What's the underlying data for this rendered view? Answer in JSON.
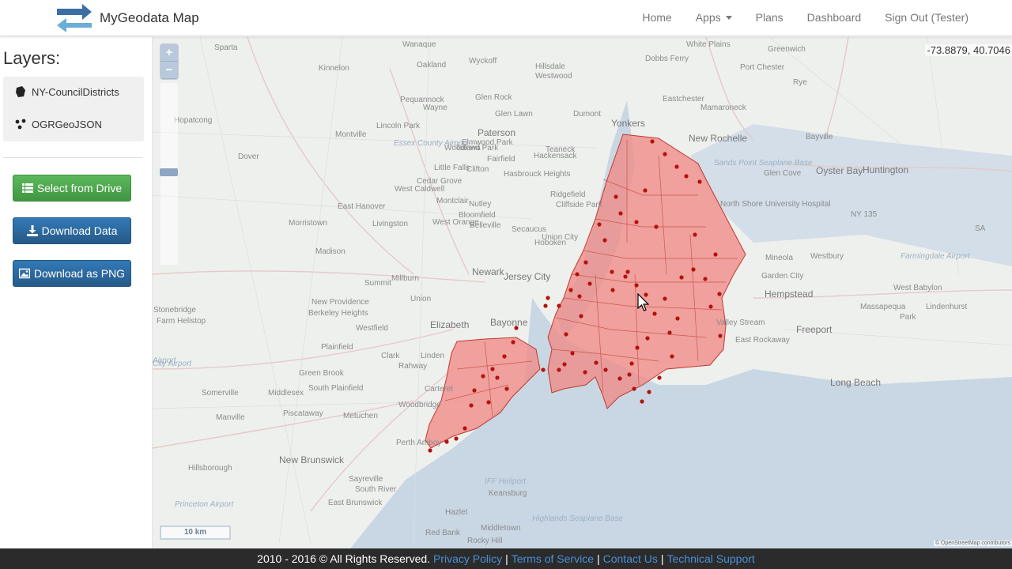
{
  "navbar": {
    "brand": "MyGeodata Map",
    "items": [
      {
        "label": "Home"
      },
      {
        "label": "Apps"
      },
      {
        "label": "Plans"
      },
      {
        "label": "Dashboard"
      },
      {
        "label": "Sign Out (Tester)"
      }
    ]
  },
  "sidebar": {
    "title": "Layers:",
    "layers": [
      {
        "label": "NY-CouncilDistricts",
        "icon": "polygon-icon"
      },
      {
        "label": "OGRGeoJSON",
        "icon": "points-icon"
      }
    ],
    "buttons": {
      "select_drive": "Select from Drive",
      "download_data": "Download Data",
      "download_png": "Download as PNG"
    }
  },
  "map": {
    "zoom_in": "+",
    "zoom_out": "−",
    "coordinates": "-73.8879, 40.7046",
    "scale": "10 km",
    "attribution": "© OpenStreetMap contributors",
    "labels": [
      "Sparta",
      "Wanaque",
      "Oakland",
      "Wyckoff",
      "Hillsdale",
      "Westwood",
      "Dobbs Ferry",
      "White Plains",
      "Greenwich",
      "Port Chester",
      "Rye",
      "Kinnelon",
      "Pequannock",
      "Wayne",
      "Glen Rock",
      "Glen Lawn",
      "Dumont",
      "Yonkers",
      "Eastchester",
      "Mamaroneck",
      "Hopatcong",
      "Lincoln Park",
      "Paterson",
      "Clifton",
      "Elmwood Park",
      "Teaneck",
      "Hackensack",
      "New Rochelle",
      "Bayville",
      "Montville",
      "Totowa",
      "Woodland Park",
      "Essex County Airport",
      "Dover",
      "Fairfield",
      "Little Falls",
      "Hasbrouck Heights",
      "Sands Point Seaplane Base",
      "Glen Cove",
      "Oyster Bay",
      "Huntington",
      "West Caldwell",
      "Cedar Grove",
      "Ridgefield",
      "Cliffside Park",
      "Montclair",
      "Nutley",
      "Bloomfield",
      "East Hanover",
      "Belleville",
      "Secaucus",
      "North Shore University Hospital",
      "NY 135",
      "SA",
      "Morristown",
      "Livingston",
      "West Orange",
      "Union City",
      "Hoboken",
      "Madison",
      "Newark",
      "Jersey City",
      "Mineola",
      "Westbury",
      "Farmingdale Airport",
      "Summit",
      "Millburn",
      "Garden City",
      "West Babylon",
      "Hempstead",
      "New Providence",
      "Union",
      "Massapequa",
      "Lindenhurst",
      "Park",
      "Berkeley Heights",
      "Elizabeth",
      "Bayonne",
      "Valley Stream",
      "Freeport",
      "East Rockaway",
      "Stonebridge",
      "Farm Helistop",
      "Westfield",
      "Plainfield",
      "Clark",
      "Rahway",
      "Linden",
      "Long Beach",
      "Green Brook",
      "Middlesex",
      "South Plainfield",
      "Somerville",
      "Carteret",
      "Woodbridge",
      "Manville",
      "Piscataway",
      "Metuchen",
      "Perth Amboy",
      "New Brunswick",
      "Hillsborough",
      "Sayreville",
      "South River",
      "IFF Heliport",
      "Keansburg",
      "East Brunswick",
      "Hazlet",
      "Middletown",
      "Red Bank",
      "Princeton Airport",
      "Highlands Seaplane Base",
      "City Airport",
      "Airport",
      "Rocky Hill"
    ]
  },
  "footer": {
    "copyright": "2010 - 2016 © All Rights Reserved.",
    "links": [
      "Privacy Policy",
      "Terms of Service",
      "Contact Us",
      "Technical Support"
    ]
  },
  "colors": {
    "polygon_fill": "#f08c88",
    "polygon_stroke": "#c0392b",
    "point": "#b3130e",
    "water": "#c9d7e4",
    "land": "#eef0ee",
    "btn_green": "#5cb85c",
    "btn_blue": "#337ab7",
    "footer_bg": "#2b2b2b",
    "link": "#4a8fd6"
  }
}
